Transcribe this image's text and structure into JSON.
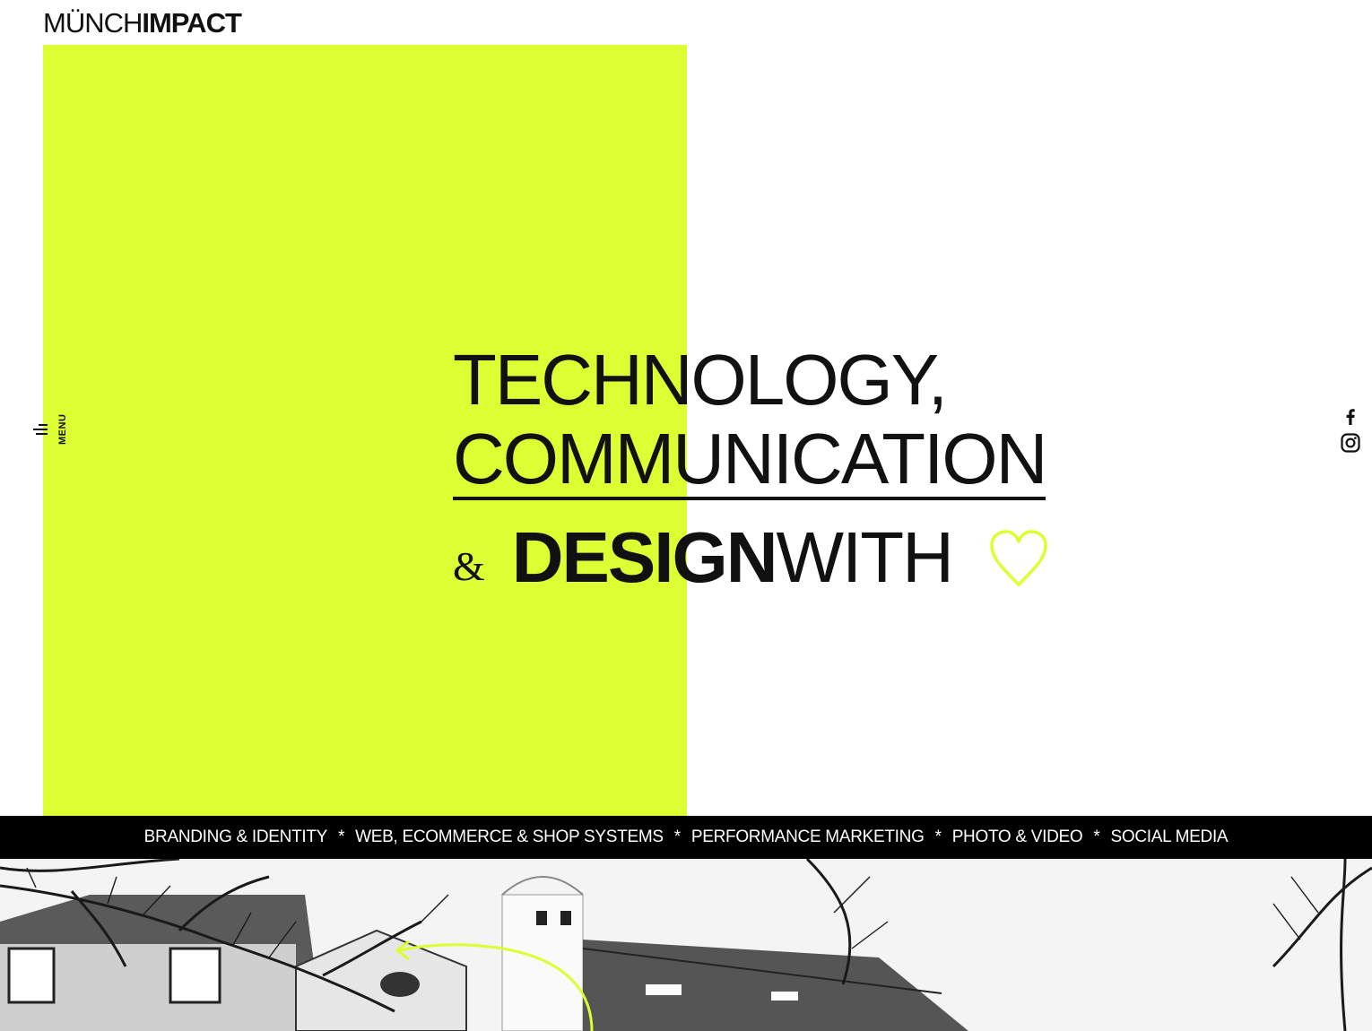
{
  "logo": {
    "light": "MÜNCH",
    "bold": "IMPACT"
  },
  "menu": {
    "label": "MENU"
  },
  "hero": {
    "line1": "TECHNOLOGY,",
    "line2": "COMMUNICATION",
    "amp": "&",
    "design": "DESIGN",
    "with": "WITH"
  },
  "social": [
    "facebook-icon",
    "instagram-icon"
  ],
  "ticker": {
    "items": [
      "BRANDING & IDENTITY",
      "WEB, ECOMMERCE & SHOP SYSTEMS",
      "PERFORMANCE MARKETING",
      "PHOTO & VIDEO",
      "SOCIAL MEDIA"
    ],
    "separator": "*"
  },
  "colors": {
    "accent": "#dcfe32",
    "text": "#111111",
    "bar": "#000000"
  }
}
